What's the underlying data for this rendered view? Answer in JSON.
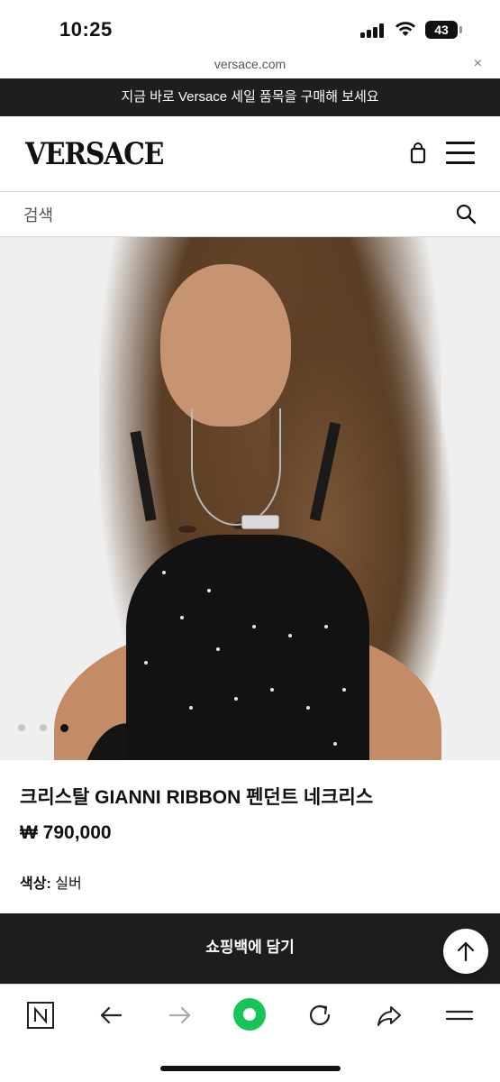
{
  "status_bar": {
    "time": "10:25",
    "battery": "43",
    "icons": [
      "signal-icon",
      "wifi-icon",
      "battery-icon"
    ]
  },
  "browser": {
    "url": "versace.com",
    "close_symbol": "×"
  },
  "promo_banner": {
    "text": "지금 바로 Versace 세일 품목을 구매해 보세요"
  },
  "header": {
    "logo": "VERSACE",
    "icons": [
      "shopping-bag-icon",
      "hamburger-menu-icon"
    ]
  },
  "search": {
    "placeholder": "검색",
    "icon": "search-icon"
  },
  "gallery": {
    "slide_count": 3,
    "active_slide": 3
  },
  "product": {
    "title": "크리스탈 GIANNI RIBBON 펜던트 네크리스",
    "price": "₩ 790,000",
    "color_label": "색상:",
    "color_value": "실버"
  },
  "actions": {
    "add_to_bag": "쇼핑백에 담기",
    "scroll_top_icon": "arrow-up-icon"
  },
  "toolbar": {
    "items": [
      "naver-n-icon",
      "back-arrow-icon",
      "forward-arrow-icon",
      "green-dot-home-icon",
      "reload-icon",
      "share-icon",
      "menu-icon"
    ]
  },
  "colors": {
    "banner_bg": "#1e1e1e",
    "button_bg": "#1d1d1d",
    "accent_green": "#16c45a"
  }
}
